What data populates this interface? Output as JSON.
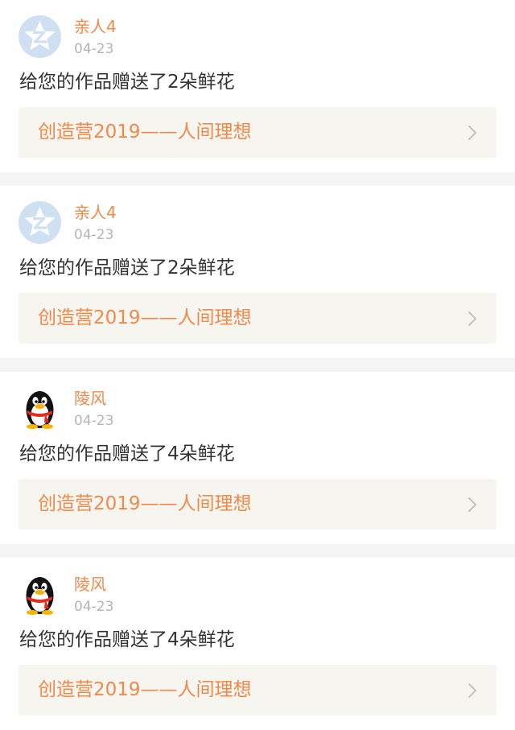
{
  "feed": {
    "items": [
      {
        "avatar_icon": "qzone-star-icon",
        "name": "亲人4",
        "date": "04-23",
        "message": "给您的作品赠送了2朵鲜花",
        "link_text": "创造营2019——人间理想"
      },
      {
        "avatar_icon": "qzone-star-icon",
        "name": "亲人4",
        "date": "04-23",
        "message": "给您的作品赠送了2朵鲜花",
        "link_text": "创造营2019——人间理想"
      },
      {
        "avatar_icon": "qq-penguin-icon",
        "name": "陵风",
        "date": "04-23",
        "message": "给您的作品赠送了4朵鲜花",
        "link_text": "创造营2019——人间理想"
      },
      {
        "avatar_icon": "qq-penguin-icon",
        "name": "陵风",
        "date": "04-23",
        "message": "给您的作品赠送了4朵鲜花",
        "link_text": "创造营2019——人间理想"
      }
    ]
  },
  "colors": {
    "accent": "#f08a4b",
    "date_gray": "#b5b5b5",
    "link_bg": "#f6f5ef",
    "separator": "#f5f5f5",
    "qzone_blue": "#cfe0f3"
  }
}
